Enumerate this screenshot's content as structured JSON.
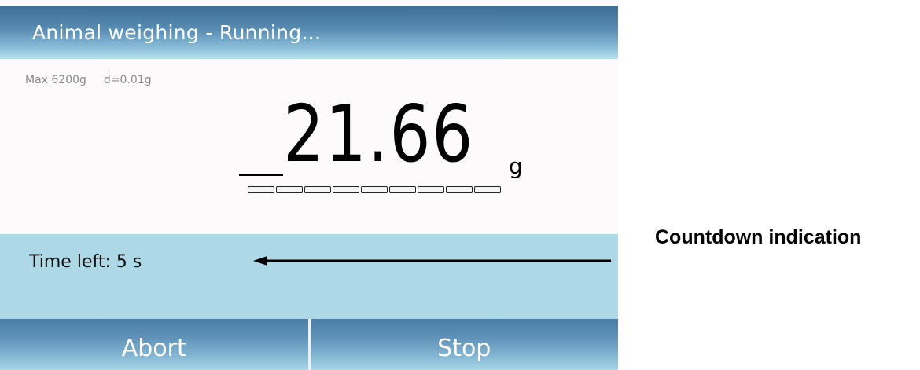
{
  "titlebar": {
    "title": "Animal weighing - Running..."
  },
  "scale": {
    "max_capacity": "Max 6200g",
    "resolution": "d=0.01g",
    "reading": "21.66",
    "unit": "g",
    "stability_segment_count": 9
  },
  "countdown": {
    "text": "Time left: 5 s"
  },
  "buttons": {
    "abort_label": "Abort",
    "stop_label": "Stop"
  },
  "annotation": {
    "label": "Countdown indication"
  },
  "colors": {
    "header_gradient_top": "#3e6f96",
    "header_gradient_bottom": "#b8e2ee",
    "countdown_panel": "#add8e6",
    "screen_background": "#fdfafc"
  }
}
